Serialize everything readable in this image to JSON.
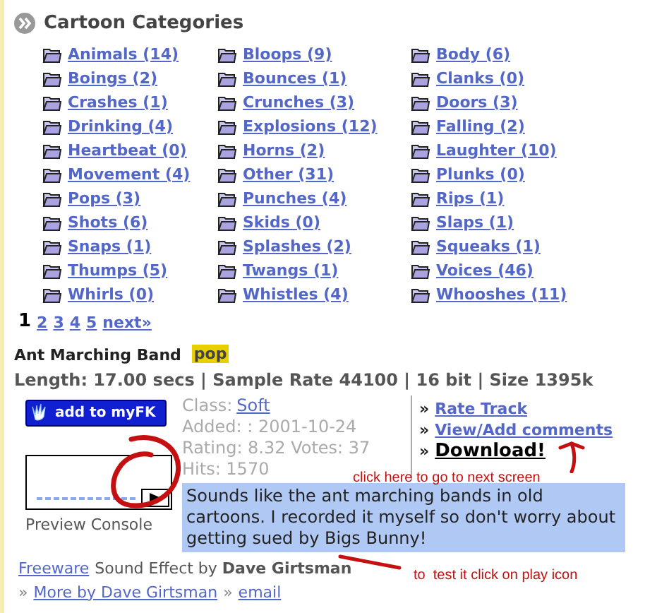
{
  "section": {
    "title": "Cartoon Categories"
  },
  "categories": [
    "Animals (14)",
    "Bloops (9)",
    "Body (6)",
    "Boings (2)",
    "Bounces (1)",
    "Clanks (0)",
    "Crashes (1)",
    "Crunches (3)",
    "Doors (3)",
    "Drinking (4)",
    "Explosions (12)",
    "Falling (2)",
    "Heartbeat (0)",
    "Horns (2)",
    "Laughter (10)",
    "Movement (4)",
    "Other (31)",
    "Plunks (0)",
    "Pops (3)",
    "Punches (4)",
    "Rips (1)",
    "Shots (6)",
    "Skids (0)",
    "Slaps (1)",
    "Snaps (1)",
    "Splashes (2)",
    "Squeaks (1)",
    "Thumps (5)",
    "Twangs (1)",
    "Voices (46)",
    "Whirls (0)",
    "Whistles (4)",
    "Whooshes (11)"
  ],
  "pagination": [
    {
      "label": "1",
      "selected": true
    },
    {
      "label": "2",
      "selected": false
    },
    {
      "label": "3",
      "selected": false
    },
    {
      "label": "4",
      "selected": false
    },
    {
      "label": "5",
      "selected": false
    },
    {
      "label": "next»",
      "selected": false
    }
  ],
  "sound": {
    "title": "Ant Marching Band",
    "tag": "pop",
    "specs": "Length: 17.00 secs | Sample Rate 44100 | 16 bit | Size 1395k",
    "add_button": "add to myFK",
    "class_label": "Class:",
    "class_value": "Soft",
    "added": "Added: : 2001-10-24",
    "rating": "Rating: 8.32 Votes: 37",
    "hits": "Hits: 1570",
    "actions": [
      {
        "bullet": "»",
        "label": "Rate Track",
        "kind": "link"
      },
      {
        "bullet": "»",
        "label": "View/Add comments",
        "kind": "link"
      },
      {
        "bullet": "»",
        "label": "Download!",
        "kind": "download"
      }
    ],
    "preview_label": "Preview Console",
    "description": "Sounds like the ant marching bands in old cartoons. I recorded it myself so don't worry about getting sued by Bigs Bunny!",
    "license": "Freeware",
    "credit": "Sound Effect by **Dave Girtsman**",
    "more_links": [
      {
        "bullet": "»",
        "label": "More by Dave Girtsman"
      },
      {
        "bullet": "»",
        "label": "email"
      }
    ]
  },
  "annotations": [
    {
      "text": "click here to go to next screen"
    },
    {
      "text": "to  test it click on play icon"
    }
  ]
}
